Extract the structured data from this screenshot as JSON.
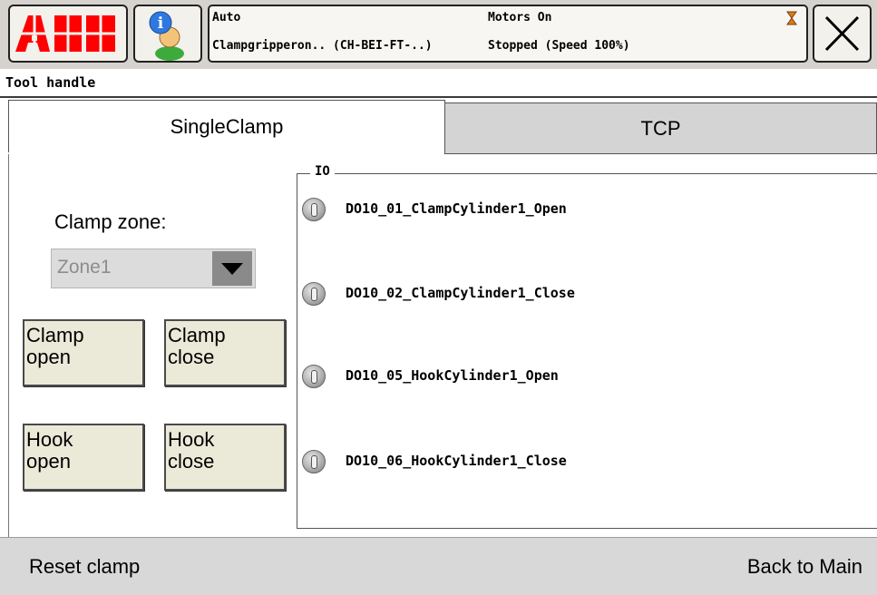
{
  "header": {
    "logo_text": "ABB",
    "status": {
      "mode": "Auto",
      "task": "Clampgripperon.. (CH-BEI-FT-..)",
      "motors": "Motors On",
      "run_state": "Stopped (Speed 100%)"
    }
  },
  "subtitle": "Tool handle",
  "tabs": [
    {
      "label": "SingleClamp",
      "active": true
    },
    {
      "label": "TCP",
      "active": false
    }
  ],
  "clamp_zone": {
    "label": "Clamp zone:",
    "selected": "Zone1"
  },
  "buttons": {
    "clamp_open": [
      "Clamp",
      "open"
    ],
    "clamp_close": [
      "Clamp",
      "close"
    ],
    "hook_open": [
      "Hook",
      "open"
    ],
    "hook_close": [
      "Hook",
      "close"
    ]
  },
  "io": {
    "legend": "IO",
    "signals": [
      {
        "name": "DO10_01_ClampCylinder1_Open",
        "value": 0
      },
      {
        "name": "DO10_02_ClampCylinder1_Close",
        "value": 0
      },
      {
        "name": "DO10_05_HookCylinder1_Open",
        "value": 0
      },
      {
        "name": "DO10_06_HookCylinder1_Close",
        "value": 0
      }
    ]
  },
  "footer": {
    "left_label": "Reset clamp",
    "right_label": "Back to Main"
  },
  "colors": {
    "logo_red": "#ff0000",
    "led_off": "#a8a8a8",
    "button_face": "#ebe9d8"
  }
}
